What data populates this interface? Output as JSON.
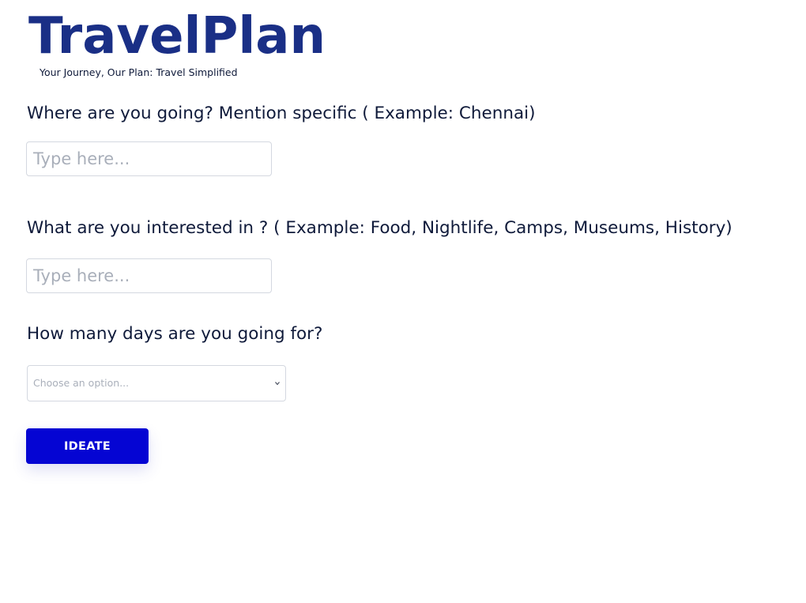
{
  "brand": {
    "title": "TravelPlan",
    "tagline": "Your Journey, Our Plan: Travel Simplified"
  },
  "form": {
    "destination": {
      "question": "Where are you going? Mention specific ( Example: Chennai)",
      "placeholder": "Type here...",
      "value": ""
    },
    "interests": {
      "question": "What are you interested in ? ( Example: Food, Nightlife, Camps, Museums, History)",
      "placeholder": "Type here...",
      "value": ""
    },
    "days": {
      "question": "How many days are you going for?",
      "selected": "Choose an option..."
    },
    "submit_label": "IDEATE"
  },
  "icons": {
    "select_arrow": "chevron-down-icon"
  },
  "colors": {
    "brand": "#1a2f86",
    "button": "#0505d3",
    "text": "#0f1a3a",
    "placeholder": "#a9afba",
    "border": "#d4d8e0"
  }
}
